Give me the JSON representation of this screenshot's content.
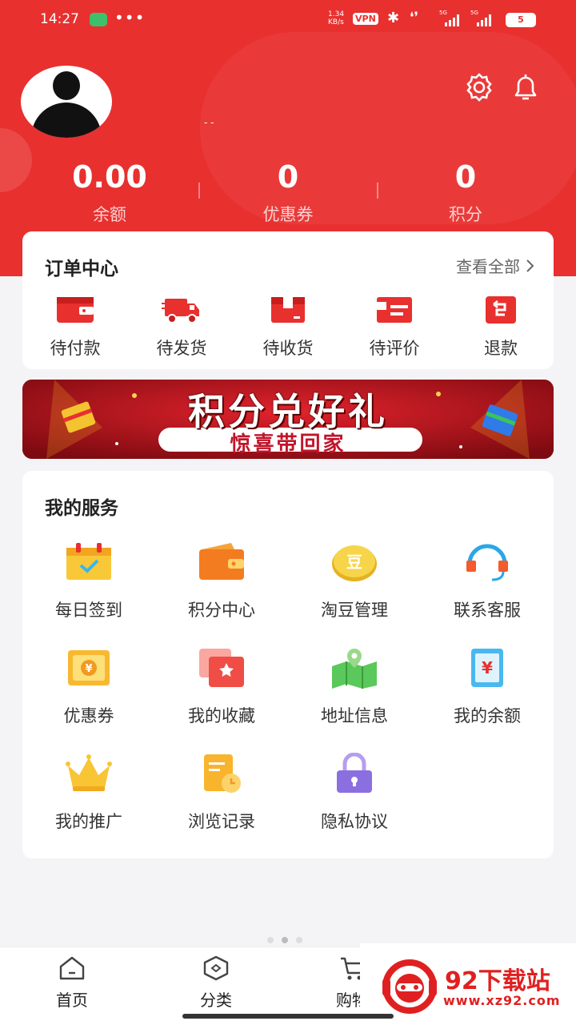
{
  "status_bar": {
    "time": "14:27",
    "dots": "•••",
    "net_speed_value": "1.34",
    "net_speed_unit": "KB/s",
    "vpn": "VPN",
    "net1": "5G",
    "net2": "5G",
    "battery": "5"
  },
  "header": {
    "username": "- -",
    "stats": [
      {
        "value": "0.00",
        "label": "余额"
      },
      {
        "value": "0",
        "label": "优惠券"
      },
      {
        "value": "0",
        "label": "积分"
      }
    ]
  },
  "orders": {
    "title": "订单中心",
    "view_all": "查看全部",
    "items": [
      {
        "label": "待付款",
        "icon": "wallet-icon"
      },
      {
        "label": "待发货",
        "icon": "truck-icon"
      },
      {
        "label": "待收货",
        "icon": "package-icon"
      },
      {
        "label": "待评价",
        "icon": "review-icon"
      },
      {
        "label": "退款",
        "icon": "refund-icon"
      }
    ]
  },
  "banner": {
    "title": "积分兑好礼",
    "subtitle": "惊喜带回家"
  },
  "services": {
    "title": "我的服务",
    "items": [
      {
        "label": "每日签到",
        "icon": "calendar-check-icon"
      },
      {
        "label": "积分中心",
        "icon": "points-wallet-icon"
      },
      {
        "label": "淘豆管理",
        "icon": "bean-coin-icon"
      },
      {
        "label": "联系客服",
        "icon": "headset-icon"
      },
      {
        "label": "优惠券",
        "icon": "coupon-icon"
      },
      {
        "label": "我的收藏",
        "icon": "favorite-star-icon"
      },
      {
        "label": "地址信息",
        "icon": "map-location-icon"
      },
      {
        "label": "我的余额",
        "icon": "balance-yuan-icon"
      },
      {
        "label": "我的推广",
        "icon": "crown-icon"
      },
      {
        "label": "浏览记录",
        "icon": "history-doc-icon"
      },
      {
        "label": "隐私协议",
        "icon": "lock-icon"
      }
    ]
  },
  "tabbar": {
    "tabs": [
      {
        "label": "首页",
        "icon": "home-icon"
      },
      {
        "label": "分类",
        "icon": "category-icon"
      },
      {
        "label": "购物",
        "icon": "cart-icon"
      }
    ]
  },
  "watermark": {
    "name": "92下载站",
    "url": "www.xz92.com"
  },
  "colors": {
    "brand_red": "#e8302f",
    "background": "#f4f4f6"
  }
}
